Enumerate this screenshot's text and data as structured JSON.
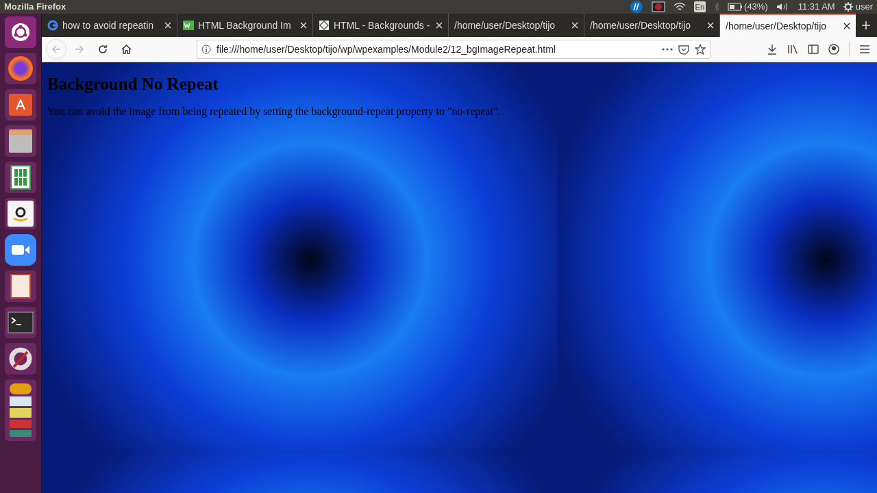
{
  "top_bar": {
    "app_title": "Mozilla Firefox",
    "keyboard": "En",
    "battery": "(43%)",
    "time": "11:31 AM",
    "user": "user"
  },
  "tabs": [
    {
      "label": "how to avoid repeatin",
      "selected": false
    },
    {
      "label": "HTML Background Im",
      "selected": false
    },
    {
      "label": "HTML - Backgrounds -",
      "selected": false
    },
    {
      "label": "/home/user/Desktop/tijo",
      "selected": false
    },
    {
      "label": "/home/user/Desktop/tijo",
      "selected": false
    },
    {
      "label": "/home/user/Desktop/tijo",
      "selected": true
    }
  ],
  "address_bar": {
    "url": "file:///home/user/Desktop/tijo/wp/wpexamples/Module2/12_bgImageRepeat.html"
  },
  "page": {
    "heading": "Background No Repeat",
    "paragraph": "You can avoid the image from being repeated by setting the background-repeat property to \"no-repeat\"."
  }
}
